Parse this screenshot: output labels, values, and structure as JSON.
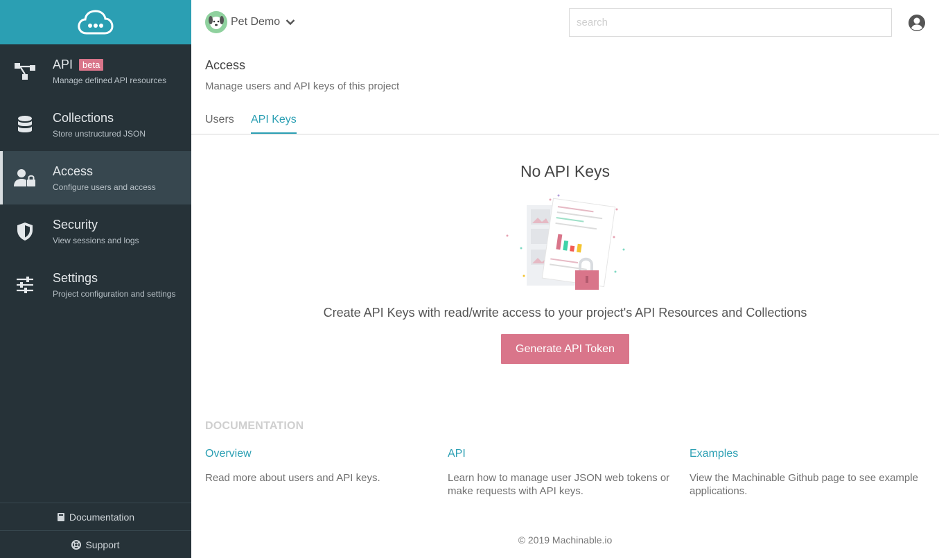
{
  "colors": {
    "brand": "#2b9fb3",
    "accent": "#d9758a",
    "sidebar": "#263238",
    "sidebar_active": "#37474f"
  },
  "logo": {
    "icon": "cloud-icon"
  },
  "sidebar": {
    "items": [
      {
        "title": "API",
        "badge": "beta",
        "subtitle": "Manage defined API resources",
        "icon": "api-tree-icon"
      },
      {
        "title": "Collections",
        "subtitle": "Store unstructured JSON",
        "icon": "database-icon"
      },
      {
        "title": "Access",
        "subtitle": "Configure users and access",
        "icon": "user-lock-icon",
        "active": true
      },
      {
        "title": "Security",
        "subtitle": "View sessions and logs",
        "icon": "shield-icon"
      },
      {
        "title": "Settings",
        "subtitle": "Project configuration and settings",
        "icon": "sliders-icon"
      }
    ],
    "footer": {
      "documentation": "Documentation",
      "support": "Support"
    }
  },
  "header": {
    "project_name": "Pet Demo",
    "search_placeholder": "search"
  },
  "page": {
    "title": "Access",
    "subtitle": "Manage users and API keys of this project",
    "tabs": [
      {
        "label": "Users"
      },
      {
        "label": "API Keys",
        "active": true
      }
    ]
  },
  "empty_state": {
    "title": "No API Keys",
    "description": "Create API Keys with read/write access to your project's API Resources and Collections",
    "button": "Generate API Token"
  },
  "documentation": {
    "heading": "DOCUMENTATION",
    "columns": [
      {
        "link": "Overview",
        "text": "Read more about users and API keys."
      },
      {
        "link": "API",
        "text": "Learn how to manage user JSON web tokens or make requests with API keys."
      },
      {
        "link": "Examples",
        "text": "View the Machinable Github page to see example applications."
      }
    ]
  },
  "footer": {
    "copyright": "© 2019 Machinable.io"
  }
}
